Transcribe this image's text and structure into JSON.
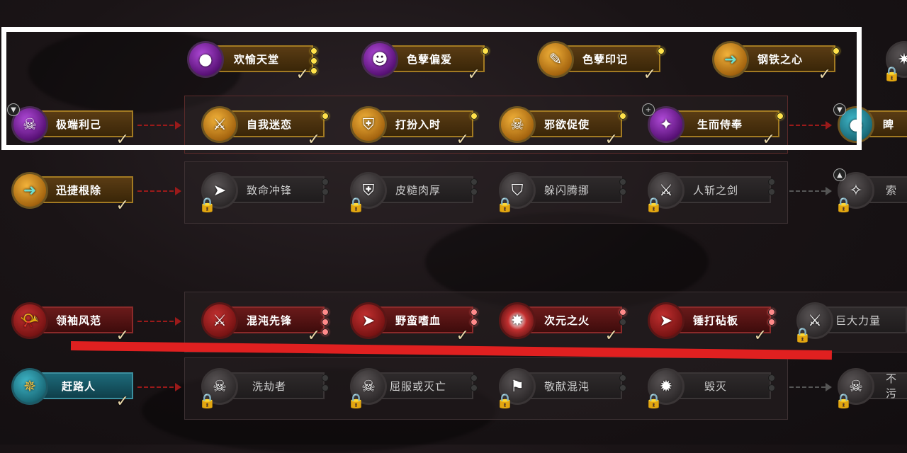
{
  "colors": {
    "highlight": "#ffffff",
    "annotation_line": "#e02020"
  },
  "row1": [
    {
      "label": "欢愉天堂",
      "icon": "orb-icon"
    },
    {
      "label": "色孽偏爱",
      "icon": "ghost-icon"
    },
    {
      "label": "色孽印记",
      "icon": "scroll-icon"
    },
    {
      "label": "钢铁之心",
      "icon": "dash-arrow-icon"
    }
  ],
  "row2": {
    "root": {
      "label": "极端利己",
      "icon": "face-icon"
    },
    "items": [
      {
        "label": "自我迷恋",
        "icon": "sword-icon"
      },
      {
        "label": "打扮入时",
        "icon": "armor-icon"
      },
      {
        "label": "邪欲促使",
        "icon": "skull-coin-icon"
      },
      {
        "label": "生而侍奉",
        "icon": "daemon-icon"
      },
      {
        "label": "睥"
      }
    ]
  },
  "row3": {
    "root": {
      "label": "迅捷根除",
      "icon": "dash-arrow-icon"
    },
    "items": [
      {
        "label": "致命冲锋"
      },
      {
        "label": "皮糙肉厚"
      },
      {
        "label": "躲闪腾挪"
      },
      {
        "label": "人斩之剑"
      },
      {
        "label": "索"
      }
    ]
  },
  "row4": {
    "root": {
      "label": "领袖风范",
      "icon": "horn-icon"
    },
    "items": [
      {
        "label": "混沌先锋"
      },
      {
        "label": "野蛮嗜血"
      },
      {
        "label": "次元之火"
      },
      {
        "label": "锤打砧板"
      },
      {
        "label": "巨大力量"
      }
    ]
  },
  "row5": {
    "root": {
      "label": "赶路人",
      "icon": "compass-icon"
    },
    "items": [
      {
        "label": "洗劫者"
      },
      {
        "label": "屈服或灭亡"
      },
      {
        "label": "敬献混沌"
      },
      {
        "label": "毁灭"
      },
      {
        "label": "不污"
      }
    ]
  }
}
